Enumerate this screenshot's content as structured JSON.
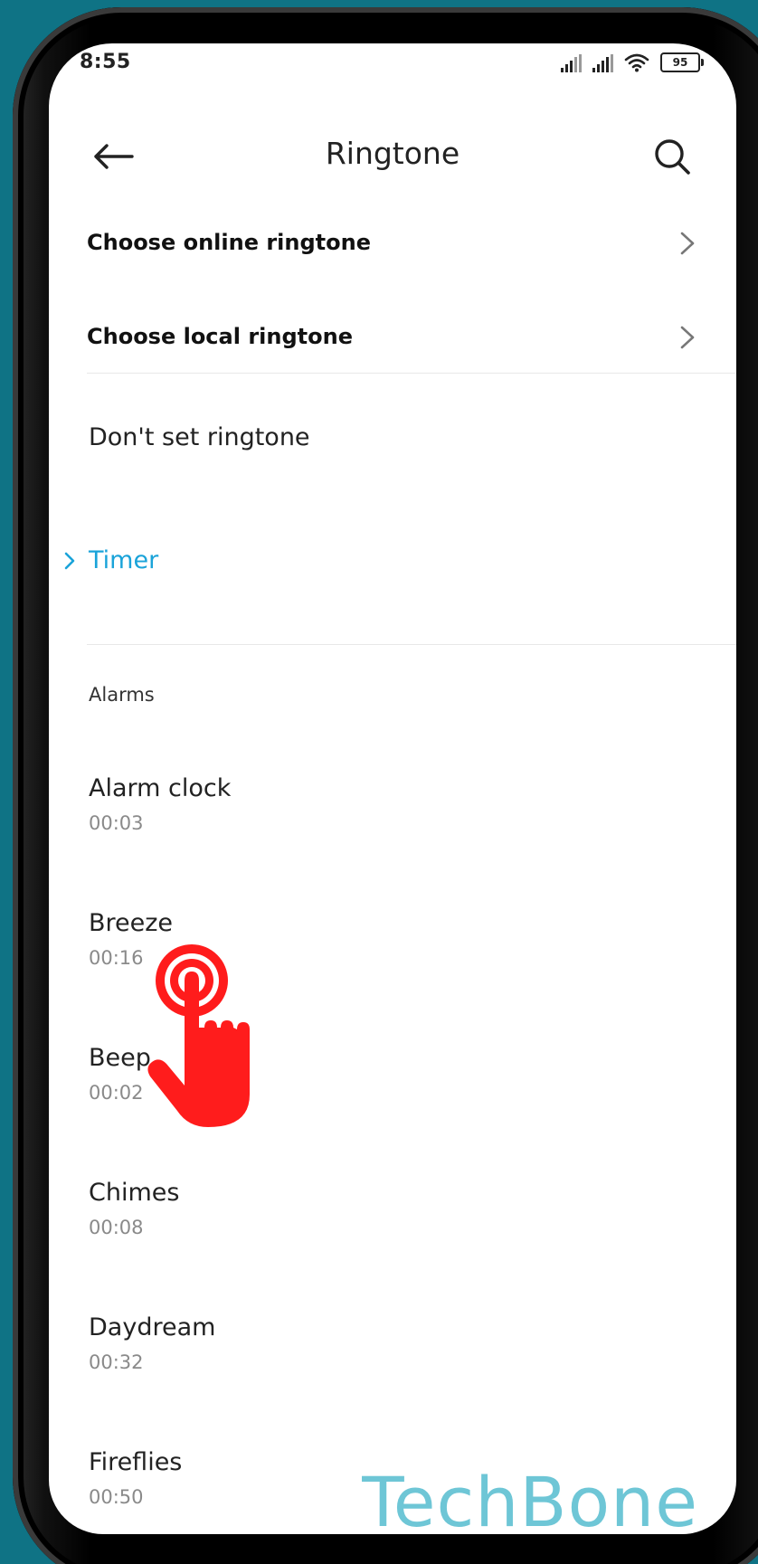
{
  "status_bar": {
    "time": "8:55",
    "battery": "95"
  },
  "app_bar": {
    "title": "Ringtone",
    "back_icon": "arrow-left-icon",
    "search_icon": "search-icon"
  },
  "nav_rows": [
    {
      "label": "Choose online ringtone"
    },
    {
      "label": "Choose local ringtone"
    }
  ],
  "dont_set_label": "Don't set ringtone",
  "timer": {
    "label": "Timer",
    "color": "#1aa3d9"
  },
  "alarms": {
    "header": "Alarms",
    "items": [
      {
        "name": "Alarm clock",
        "duration": "00:03"
      },
      {
        "name": "Breeze",
        "duration": "00:16"
      },
      {
        "name": "Beep",
        "duration": "00:02"
      },
      {
        "name": "Chimes",
        "duration": "00:08"
      },
      {
        "name": "Daydream",
        "duration": "00:32"
      },
      {
        "name": "Fireflies",
        "duration": "00:50"
      }
    ]
  },
  "overlay": {
    "tap_indicator_icon": "tap-hand-icon",
    "tap_color": "#ff1c1c"
  },
  "watermark": "TechBone"
}
